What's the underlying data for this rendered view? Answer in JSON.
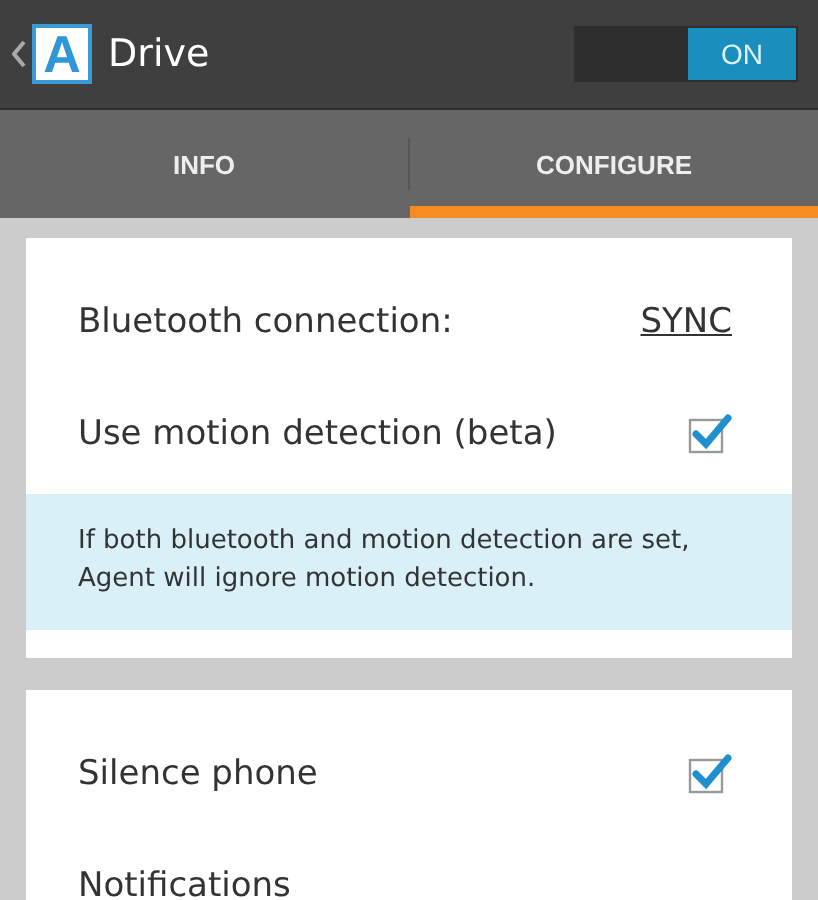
{
  "action_bar": {
    "logo_letter": "A",
    "title": "Drive",
    "toggle": {
      "label": "ON",
      "on": true
    }
  },
  "tabs": [
    {
      "label": "INFO",
      "selected": false
    },
    {
      "label": "CONFIGURE",
      "selected": true
    }
  ],
  "cards": [
    {
      "rows": [
        {
          "kind": "link",
          "label": "Bluetooth connection:",
          "value": "SYNC"
        },
        {
          "kind": "checkbox",
          "label": "Use motion detection (beta)",
          "checked": true
        },
        {
          "kind": "note",
          "text": "If both bluetooth and motion detection are set, Agent will ignore motion detection."
        }
      ]
    },
    {
      "rows": [
        {
          "kind": "checkbox",
          "label": "Silence phone",
          "checked": true
        },
        {
          "kind": "plain",
          "label": "Notifications"
        }
      ]
    }
  ]
}
